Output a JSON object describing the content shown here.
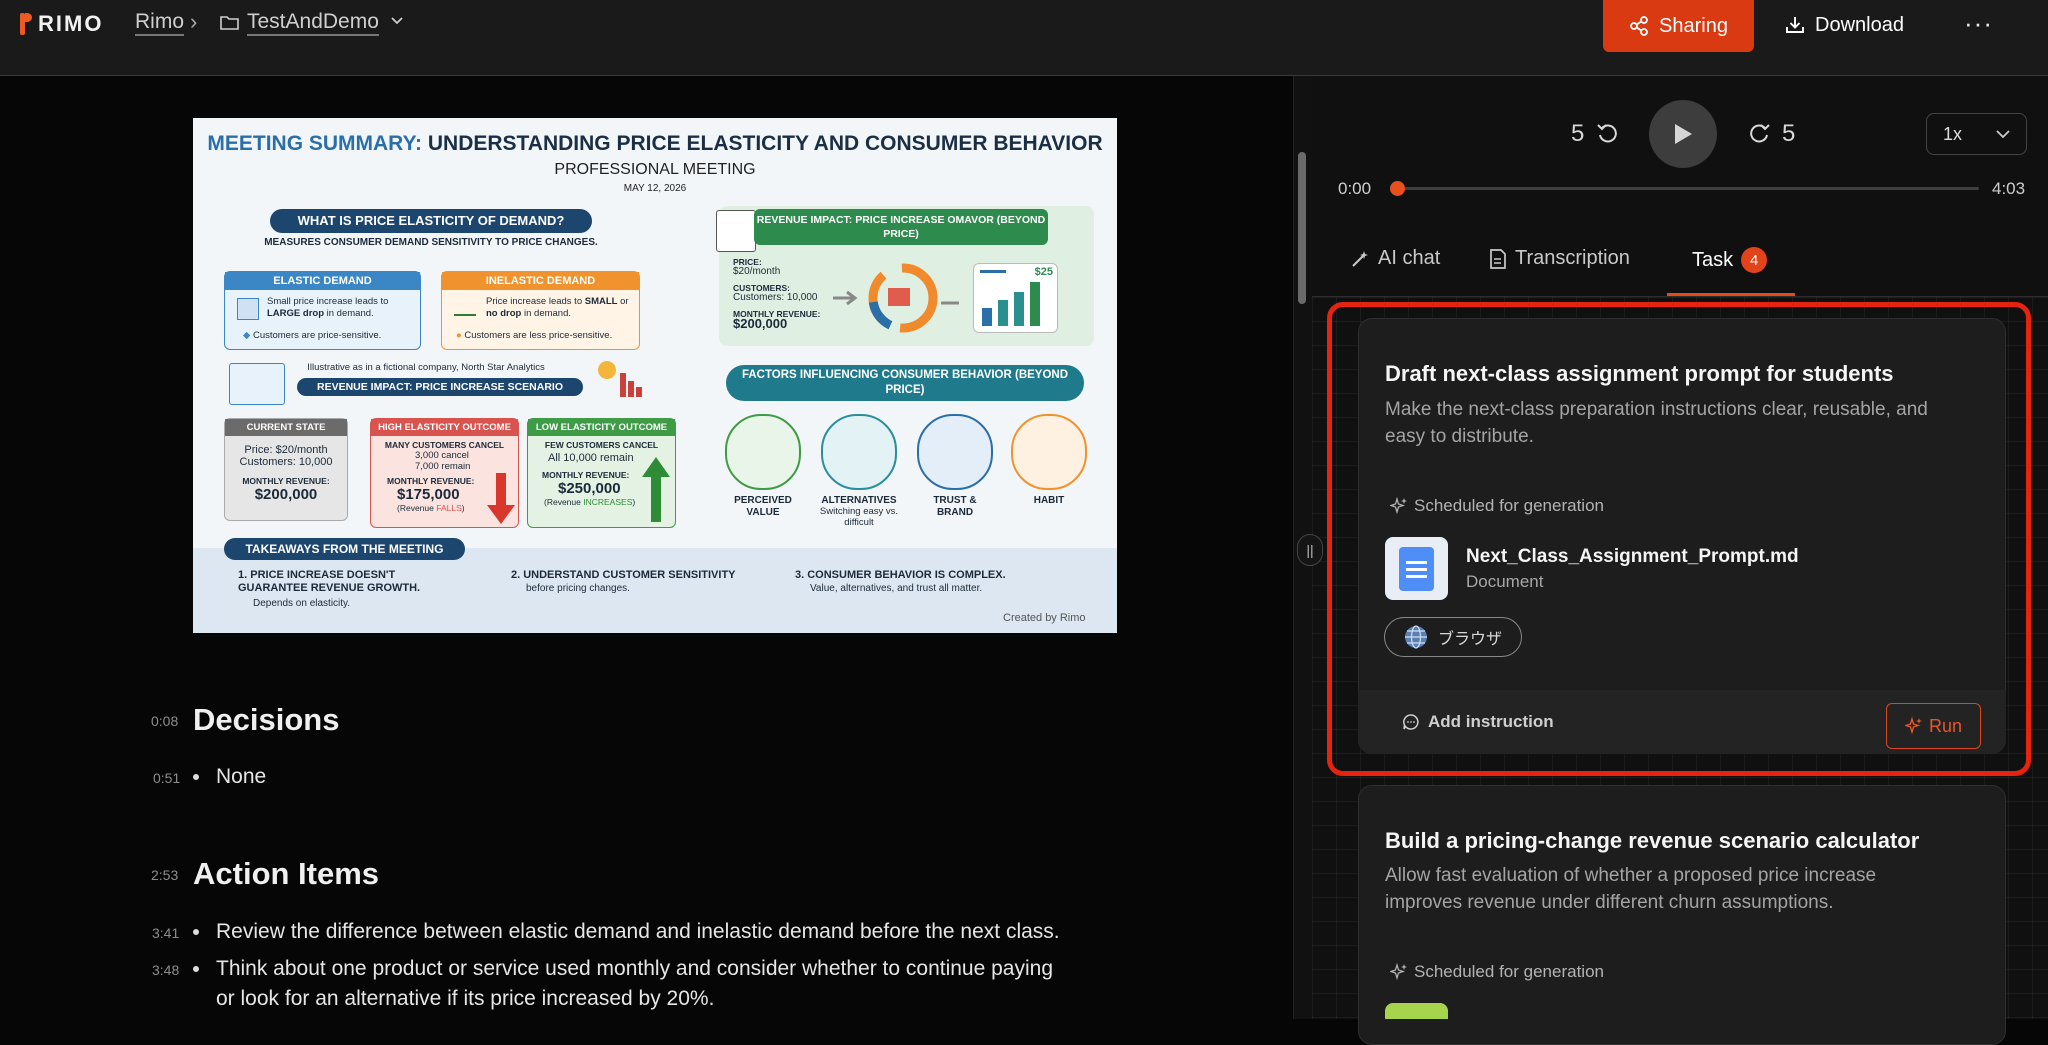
{
  "app": {
    "logo_text": "RIMO"
  },
  "breadcrumb": {
    "root": "Rimo",
    "separator": "›",
    "folder": "TestAndDemo"
  },
  "header": {
    "share_label": "Sharing",
    "download_label": "Download",
    "more_label": "···"
  },
  "infographic": {
    "title_prefix": "MEETING SUMMARY:",
    "title_rest": "UNDERSTANDING PRICE ELASTICITY AND CONSUMER BEHAVIOR",
    "subtitle": "PROFESSIONAL MEETING",
    "date": "MAY 12, 2026",
    "what_is": "WHAT IS PRICE ELASTICITY OF DEMAND?",
    "what_is_desc": "MEASURES CONSUMER DEMAND SENSITIVITY TO PRICE CHANGES.",
    "elastic_title": "ELASTIC DEMAND",
    "elastic_line1a": "Small price increase leads to",
    "elastic_line1b": "LARGE drop",
    "elastic_line1c": "in demand.",
    "elastic_line2": "Customers are price-sensitive.",
    "inelastic_title": "INELASTIC DEMAND",
    "inelastic_line1a": "Price increase leads to",
    "inelastic_line1b": "SMALL",
    "inelastic_line1c": "or",
    "inelastic_line1d": "no drop",
    "inelastic_line1e": "in demand.",
    "inelastic_line2": "Customers are less price-sensitive.",
    "illustrative": "Illustrative as in a fictional company, North Star Analytics",
    "revenue_scenario": "REVENUE IMPACT: PRICE INCREASE SCENARIO",
    "current_title": "CURRENT STATE",
    "current_l1": "Price: $20/month",
    "current_l2": "Customers: 10,000",
    "current_l3": "MONTHLY REVENUE:",
    "current_val": "$200,000",
    "high_title": "HIGH ELASTICITY OUTCOME",
    "high_l1": "MANY CUSTOMERS CANCEL",
    "high_l2": "3,000 cancel",
    "high_l3": "7,000 remain",
    "high_l4": "MONTHLY REVENUE:",
    "high_val": "$175,000",
    "high_note_a": "(Revenue",
    "high_note_b": "FALLS",
    "high_note_c": ")",
    "low_title": "LOW ELASTICITY OUTCOME",
    "low_l1": "FEW CUSTOMERS CANCEL",
    "low_l2": "All 10,000 remain",
    "low_l3": "MONTHLY REVENUE:",
    "low_val": "$250,000",
    "low_note_a": "(Revenue",
    "low_note_b": "INCREASES",
    "low_note_c": ")",
    "rev_impact_title": "REVENUE IMPACT: PRICE INCREASE OMAVOR (BEYOND PRICE)",
    "ri_price_label": "PRICE:",
    "ri_price": "$20/month",
    "ri_cust_label": "CUSTOMERS:",
    "ri_cust": "Customers: 10,000",
    "ri_rev_label": "MONTHLY REVENUE:",
    "ri_rev": "$200,000",
    "ri_chart_label": "$25",
    "factors_title": "FACTORS INFLUENCING CONSUMER BEHAVIOR (BEYOND PRICE)",
    "factors": [
      {
        "label": "PERCEIVED VALUE",
        "sub": ""
      },
      {
        "label": "ALTERNATIVES",
        "sub": "Switching easy vs. difficult"
      },
      {
        "label": "TRUST & BRAND",
        "sub": ""
      },
      {
        "label": "HABIT",
        "sub": ""
      }
    ],
    "takeaways_title": "TAKEAWAYS FROM THE MEETING",
    "t1_title": "1. PRICE INCREASE DOESN'T GUARANTEE REVENUE GROWTH.",
    "t1_sub": "Depends on elasticity.",
    "t2_title": "2. UNDERSTAND CUSTOMER SENSITIVITY",
    "t2_sub": "before pricing changes.",
    "t3_title": "3. CONSUMER BEHAVIOR IS COMPLEX.",
    "t3_sub": "Value, alternatives, and trust all matter.",
    "credit": "Created by Rimo"
  },
  "summary": {
    "decisions": {
      "time": "0:08",
      "title": "Decisions"
    },
    "decision_items": [
      {
        "time": "0:51",
        "text": "None"
      }
    ],
    "actions": {
      "time": "2:53",
      "title": "Action Items"
    },
    "action_items": [
      {
        "time": "3:41",
        "text": "Review the difference between elastic demand and inelastic demand before the next class."
      },
      {
        "time": "3:48",
        "text": "Think about one product or service used monthly and consider whether to continue paying",
        "text2": "or look for an alternative if its price increased by 20%."
      }
    ]
  },
  "player": {
    "back_seconds": "5",
    "forward_seconds": "5",
    "speed": "1x",
    "current_time": "0:00",
    "total_time": "4:03",
    "progress": 0
  },
  "tabs": [
    {
      "label": "AI chat"
    },
    {
      "label": "Transcription"
    },
    {
      "label": "Task",
      "badge": "4"
    }
  ],
  "tasks": [
    {
      "title": "Draft next-class assignment prompt for students",
      "description": "Make the next-class preparation instructions clear, reusable, and easy to distribute.",
      "status": "Scheduled for generation",
      "file_name": "Next_Class_Assignment_Prompt.md",
      "file_type": "Document",
      "chip": "ブラウザ",
      "add_instruction": "Add instruction",
      "run": "Run"
    },
    {
      "title": "Build a pricing-change revenue scenario calculator",
      "description": "Allow fast evaluation of whether a proposed price increase improves revenue under different churn assumptions.",
      "status": "Scheduled for generation"
    }
  ],
  "colors": {
    "accent": "#e2431a",
    "highlight": "#e6230f",
    "background": "#060606",
    "panel": "#101010"
  }
}
